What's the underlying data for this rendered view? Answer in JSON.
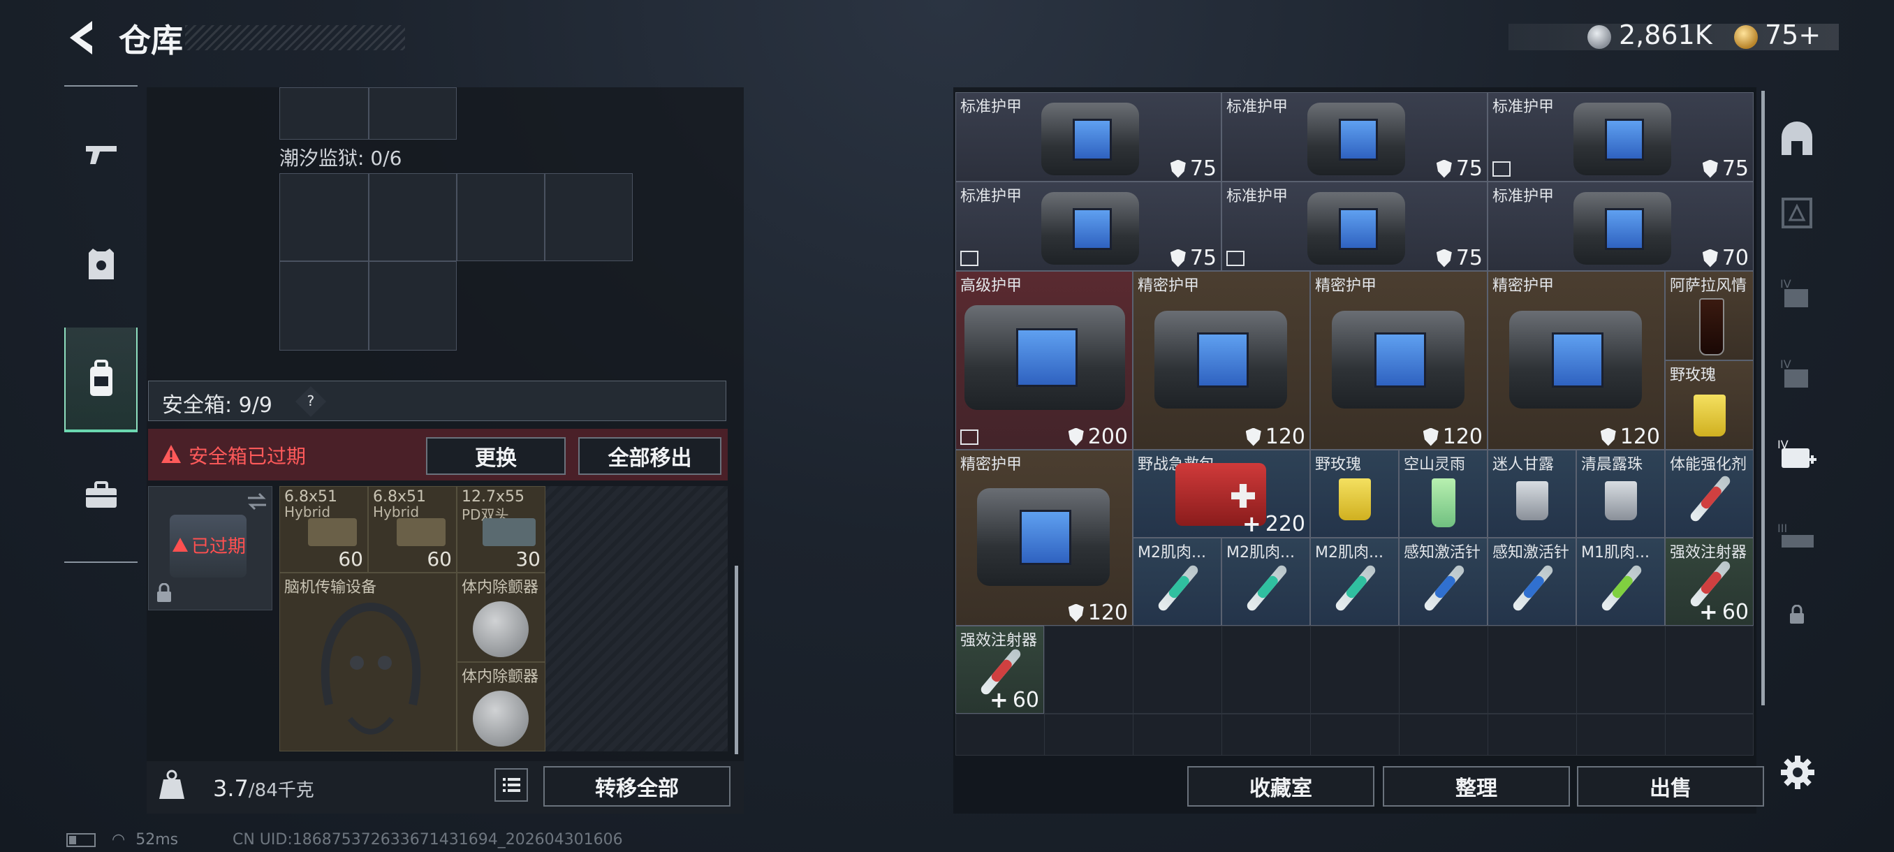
{
  "header": {
    "title": "仓库",
    "currency1_value": "2,861K",
    "currency2_value": "75+"
  },
  "left_nav": {
    "items": [
      "weapon-icon",
      "armor-vest-icon",
      "backpack-icon",
      "briefcase-icon"
    ],
    "active_index": 2
  },
  "left_panel": {
    "tide_prison_label": "潮汐监狱: 0/6",
    "safebox_label": "安全箱: 9/9",
    "help_label": "?",
    "warning_text": "安全箱已过期",
    "replace_button": "更换",
    "move_all_out_button": "全部移出",
    "expired_label": "已过期",
    "items": [
      {
        "name": "6.8x51",
        "sub": "Hybrid",
        "count": "60"
      },
      {
        "name": "6.8x51",
        "sub": "Hybrid",
        "count": "60"
      },
      {
        "name": "12.7x55",
        "sub": "PD双头",
        "count": "30"
      },
      {
        "name": "脑机传输设备",
        "sub": "",
        "count": ""
      },
      {
        "name": "体内除颤器",
        "sub": "",
        "count": ""
      },
      {
        "name": "体内除颤器",
        "sub": "",
        "count": ""
      }
    ],
    "weight_value": "3.7",
    "weight_capacity": "/84千克",
    "transfer_all_button": "转移全部"
  },
  "status_bar": {
    "ping": "52ms",
    "uid": "CN UID:186875372633671431694_202604301606"
  },
  "inventory": {
    "row1": [
      {
        "name": "标准护甲",
        "value": "75",
        "broken": false
      },
      {
        "name": "标准护甲",
        "value": "75",
        "broken": false
      },
      {
        "name": "标准护甲",
        "value": "75",
        "broken": true
      }
    ],
    "row2": [
      {
        "name": "标准护甲",
        "value": "75",
        "broken": true
      },
      {
        "name": "标准护甲",
        "value": "75",
        "broken": true
      },
      {
        "name": "标准护甲",
        "value": "70",
        "broken": false
      }
    ],
    "row3": [
      {
        "name": "高级护甲",
        "value": "200"
      },
      {
        "name": "精密护甲",
        "value": "120"
      },
      {
        "name": "精密护甲",
        "value": "120"
      },
      {
        "name": "精密护甲",
        "value": "120"
      },
      {
        "name": "阿萨拉风情"
      },
      {
        "name": "野玫瑰"
      }
    ],
    "row4": [
      {
        "name": "精密护甲",
        "value": "120"
      },
      {
        "name": "野战急救包",
        "value": "220"
      },
      {
        "name": "野玫瑰"
      },
      {
        "name": "空山灵雨"
      },
      {
        "name": "迷人甘露"
      },
      {
        "name": "清晨露珠"
      },
      {
        "name": "体能强化剂"
      }
    ],
    "row5": [
      {
        "name": "M2肌肉..."
      },
      {
        "name": "M2肌肉..."
      },
      {
        "name": "M2肌肉..."
      },
      {
        "name": "感知激活针"
      },
      {
        "name": "感知激活针"
      },
      {
        "name": "M1肌肉..."
      },
      {
        "name": "强效注射器",
        "value": "60"
      }
    ],
    "row6": [
      {
        "name": "强效注射器",
        "value": "60"
      }
    ]
  },
  "bottom_buttons": {
    "collection": "收藏室",
    "sort": "整理",
    "sell": "出售"
  },
  "colors": {
    "accent_green": "#6ad8b0",
    "warning_red": "#ff5a5a",
    "gold": "#d0a040"
  }
}
